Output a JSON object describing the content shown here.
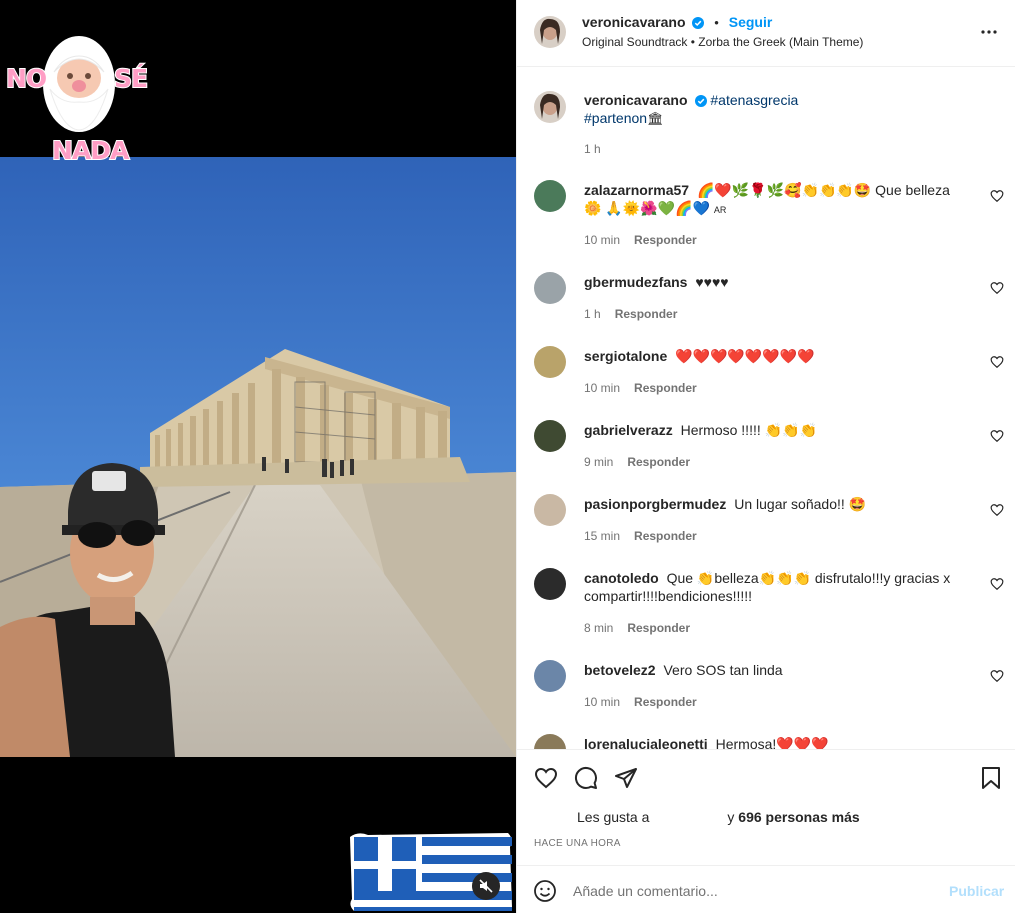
{
  "media": {
    "sticker": {
      "word1": "NO",
      "word2": "SÉ",
      "word3": "NADA"
    },
    "mute_icon": "speaker-muted-icon"
  },
  "header": {
    "username": "veronicavarano",
    "separator": "•",
    "follow_label": "Seguir",
    "audio": "Original Soundtrack • Zorba the Greek (Main Theme)",
    "more_icon": "more-options-icon"
  },
  "caption": {
    "username": "veronicavarano",
    "hashtag1": "#atenasgrecia",
    "hashtag2": "#partenon",
    "hashtag2_emoji": "🏛",
    "time": "1 h"
  },
  "reply_label": "Responder",
  "comments": [
    {
      "username": "zalazarnorma57",
      "text": "🌈❤️🌿🌹🌿🥰👏👏👏🤩 Que belleza 🌼 🙏🌞🌺💚🌈💙",
      "suffix": "AR",
      "time": "10 min",
      "avatar_color": "#4b7a5a"
    },
    {
      "username": "gbermudezfans",
      "text": "♥♥♥♥",
      "suffix": "",
      "time": "1 h",
      "avatar_color": "#9aa3a8"
    },
    {
      "username": "sergiotalone",
      "text": "❤️❤️❤️❤️❤️❤️❤️❤️",
      "suffix": "",
      "time": "10 min",
      "avatar_color": "#b9a36a"
    },
    {
      "username": "gabrielverazz",
      "text": "Hermoso !!!!! 👏👏👏",
      "suffix": "",
      "time": "9 min",
      "avatar_color": "#3f4a32"
    },
    {
      "username": "pasionporgbermudez",
      "text": "Un lugar soñado!! 🤩",
      "suffix": "",
      "time": "15 min",
      "avatar_color": "#c9b8a4"
    },
    {
      "username": "canotoledo",
      "text": "Que 👏belleza👏👏👏 disfrutalo!!!y gracias x compartir!!!!bendiciones!!!!!",
      "suffix": "",
      "time": "8 min",
      "avatar_color": "#2b2b2b"
    },
    {
      "username": "betovelez2",
      "text": "Vero SOS tan linda",
      "suffix": "",
      "time": "10 min",
      "avatar_color": "#6b86a8"
    },
    {
      "username": "lorenalucialeonetti",
      "text": "Hermosa!❤️❤️❤️",
      "suffix": "",
      "time": "",
      "avatar_color": "#8a7a5a"
    }
  ],
  "actions": {
    "like_icon": "heart-icon",
    "comment_icon": "comment-icon",
    "share_icon": "paper-plane-icon",
    "save_icon": "bookmark-icon",
    "likes_prefix": "Les gusta a",
    "likes_connector": "y",
    "likes_count": "696 personas más",
    "timeago": "HACE UNA HORA"
  },
  "comment_bar": {
    "emoji_icon": "smiley-icon",
    "placeholder": "Añade un comentario...",
    "publish_label": "Publicar"
  },
  "colors": {
    "accent": "#0095f6",
    "link": "#00376b",
    "muted": "#737373",
    "publish_disabled": "#b2dffc"
  }
}
